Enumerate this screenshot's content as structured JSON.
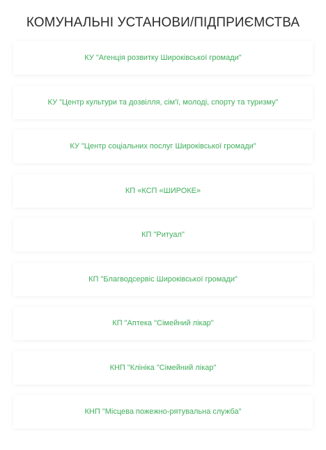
{
  "title": "КОМУНАЛЬНІ УСТАНОВИ/ПІДПРИЄМСТВА",
  "accent_color": "#3fae5b",
  "items": [
    {
      "label": "КУ \"Агенція розвитку Широківської громади\""
    },
    {
      "label": "КУ \"Центр культури та дозвілля, сім'ї, молоді, спорту та туризму\""
    },
    {
      "label": "КУ \"Центр соціальних послуг Широківської громади\""
    },
    {
      "label": "КП «КСП «ШИРОКЕ»"
    },
    {
      "label": "КП \"Ритуал\""
    },
    {
      "label": "КП \"Благводсервіс Широківської громади\""
    },
    {
      "label": "КП \"Аптека \"Сімейний лікар\""
    },
    {
      "label": "КНП \"Клініка \"Сімейний лікар\""
    },
    {
      "label": "КНП \"Місцева пожежно-рятувальна служба\""
    }
  ]
}
